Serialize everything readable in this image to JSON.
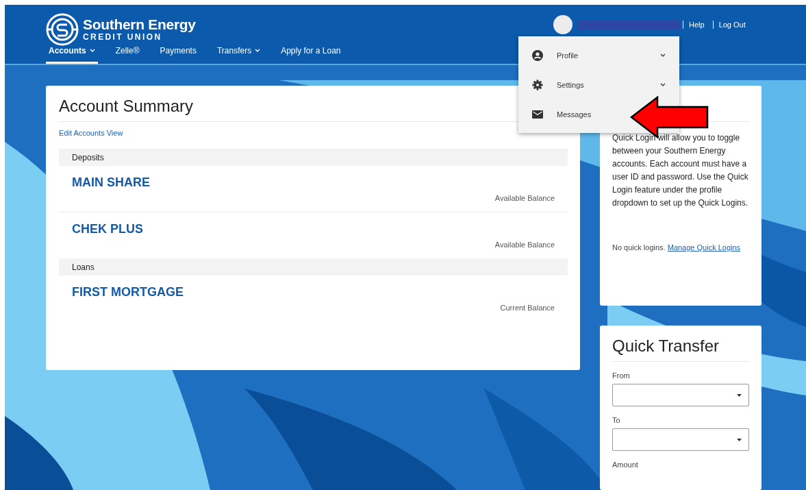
{
  "header": {
    "logo": {
      "name": "Southern Energy",
      "subtitle": "CREDIT UNION"
    },
    "nav": [
      {
        "label": "Accounts",
        "selected": true,
        "has_menu": true
      },
      {
        "label": "Zelle®",
        "selected": false,
        "has_menu": false
      },
      {
        "label": "Payments",
        "selected": false,
        "has_menu": false
      },
      {
        "label": "Transfers",
        "selected": false,
        "has_menu": true
      },
      {
        "label": "Apply for a Loan",
        "selected": false,
        "has_menu": false
      }
    ],
    "user_links": [
      "Help",
      "Log Out"
    ]
  },
  "user_menu": {
    "items": [
      {
        "label": "Profile",
        "kind": "profile",
        "expandable": true
      },
      {
        "label": "Settings",
        "kind": "settings",
        "expandable": true
      },
      {
        "label": "Messages",
        "kind": "messages",
        "expandable": false
      }
    ]
  },
  "account_summary": {
    "title": "Account Summary",
    "edit_link": "Edit Accounts View",
    "groups": [
      {
        "label": "Deposits",
        "accounts": [
          {
            "name": "MAIN SHARE",
            "balance_label": "Available Balance"
          },
          {
            "name": "CHEK PLUS",
            "balance_label": "Available Balance"
          }
        ]
      },
      {
        "label": "Loans",
        "accounts": [
          {
            "name": "FIRST MORTGAGE",
            "balance_label": "Current Balance"
          }
        ]
      }
    ]
  },
  "quick_login": {
    "text": "Quick Login will allow you to toggle between your Southern Energy accounts. Each account must have a user ID and password. Use the Quick Login feature under the profile dropdown to set up the Quick Logins.",
    "empty_text": "No quick logins.",
    "link": "Manage Quick Logins"
  },
  "quick_transfer": {
    "title": "Quick Transfer",
    "fields": [
      {
        "label": "From",
        "kind": "select"
      },
      {
        "label": "To",
        "kind": "select"
      },
      {
        "label": "Amount"
      }
    ]
  }
}
